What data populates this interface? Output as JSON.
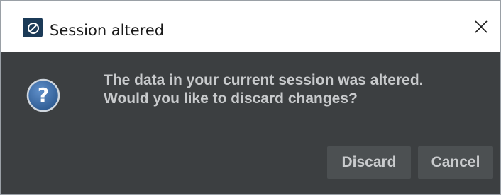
{
  "dialog": {
    "title": "Session altered",
    "app_icon": "app-logo-icon",
    "close_icon": "close-icon",
    "message_icon": "question-icon",
    "message_lines": [
      "The data in your current session was altered.",
      "Would you like to discard changes?"
    ],
    "buttons": {
      "discard_label": "Discard",
      "cancel_label": "Cancel"
    }
  },
  "colors": {
    "title_bar": "#ffffff",
    "dialog_background": "#3c3f41",
    "button_background": "#4c5052",
    "text": "#c8cacc",
    "question_icon": "#3e6ea6"
  }
}
